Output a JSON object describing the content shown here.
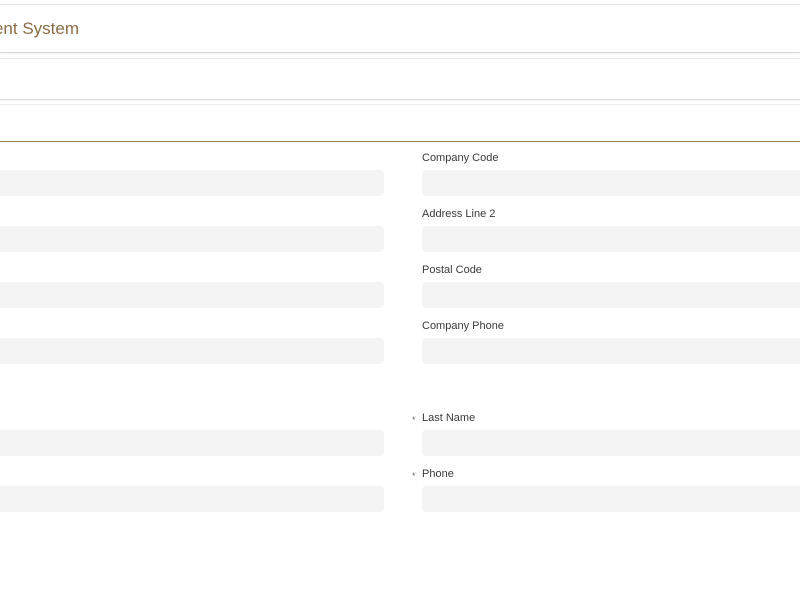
{
  "app": {
    "title": "nagement System"
  },
  "colors": {
    "accent": "#8a6b45",
    "input_bg": "#f4f4f4",
    "divider": "#9c7b55"
  },
  "form": {
    "required_mark": "*",
    "right_fields": [
      {
        "label": "Company Code",
        "value": ""
      },
      {
        "label": "Address Line 2",
        "value": ""
      },
      {
        "label": "Postal Code",
        "value": ""
      },
      {
        "label": "Company Phone",
        "value": ""
      }
    ],
    "contact_fields": [
      {
        "label": "Last Name",
        "value": "",
        "required": true
      },
      {
        "label": "Phone",
        "value": "",
        "required": true
      }
    ],
    "left_fields": [
      {
        "value": ""
      },
      {
        "value": ""
      },
      {
        "value": ""
      },
      {
        "value": ""
      },
      {
        "value": ""
      },
      {
        "value": ""
      }
    ]
  }
}
